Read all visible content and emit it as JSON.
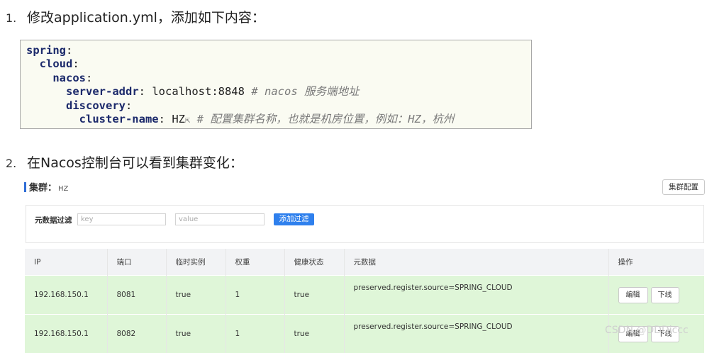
{
  "step1": {
    "num": "1.",
    "text": "修改application.yml，添加如下内容："
  },
  "code": {
    "l1": "spring",
    "l2": "cloud",
    "l3": "nacos",
    "l4_key": "server-addr",
    "l4_val": "localhost:8848",
    "l4_cmt": "# nacos 服务端地址",
    "l5": "discovery",
    "l6_key": "cluster-name",
    "l6_val": "HZ",
    "l6_cmt": "# 配置集群名称，也就是机房位置，例如：HZ，杭州"
  },
  "step2": {
    "num": "2.",
    "text": "在Nacos控制台可以看到集群变化："
  },
  "panel": {
    "label": "集群：",
    "value": "HZ",
    "config_button": "集群配置"
  },
  "filter": {
    "label": "元数据过滤",
    "key_placeholder": "key",
    "value_placeholder": "value",
    "add_button": "添加过滤"
  },
  "table": {
    "headers": [
      "IP",
      "端口",
      "临时实例",
      "权重",
      "健康状态",
      "元数据",
      "操作"
    ],
    "rows": [
      {
        "ip": "192.168.150.1",
        "port": "8081",
        "ephemeral": "true",
        "weight": "1",
        "healthy": "true",
        "metadata": "preserved.register.source=SPRING_CLOUD"
      },
      {
        "ip": "192.168.150.1",
        "port": "8082",
        "ephemeral": "true",
        "weight": "1",
        "healthy": "true",
        "metadata": "preserved.register.source=SPRING_CLOUD"
      }
    ],
    "edit_label": "编辑",
    "offline_label": "下线"
  },
  "watermark": "CSDN @DDDiccc"
}
